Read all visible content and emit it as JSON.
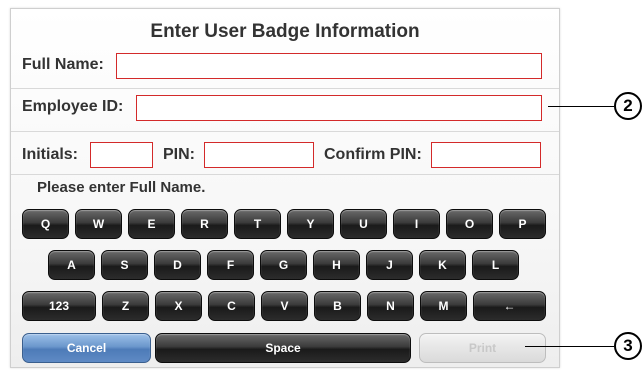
{
  "dialog": {
    "title": "Enter User Badge Information",
    "prompt": "Please enter Full Name."
  },
  "fields": {
    "full_name_label": "Full Name:",
    "full_name_value": "",
    "employee_id_label": "Employee ID:",
    "employee_id_value": "",
    "initials_label": "Initials:",
    "initials_value": "",
    "pin_label": "PIN:",
    "pin_value": "",
    "confirm_pin_label": "Confirm PIN:",
    "confirm_pin_value": ""
  },
  "keyboard": {
    "row1": [
      "Q",
      "W",
      "E",
      "R",
      "T",
      "Y",
      "U",
      "I",
      "O",
      "P"
    ],
    "row2": [
      "A",
      "S",
      "D",
      "F",
      "G",
      "H",
      "J",
      "K",
      "L"
    ],
    "row3": [
      "123",
      "Z",
      "X",
      "C",
      "V",
      "B",
      "N",
      "M",
      "←"
    ]
  },
  "actions": {
    "cancel_label": "Cancel",
    "space_label": "Space",
    "print_label": "Print",
    "print_enabled": false
  },
  "callouts": {
    "employee_id": "2",
    "print": "3"
  },
  "colors": {
    "field_border": "#d32a2a",
    "key_dark": "#2c2c2c",
    "cancel_blue": "#6b97cc",
    "disabled_gray": "#e0e0e0"
  }
}
